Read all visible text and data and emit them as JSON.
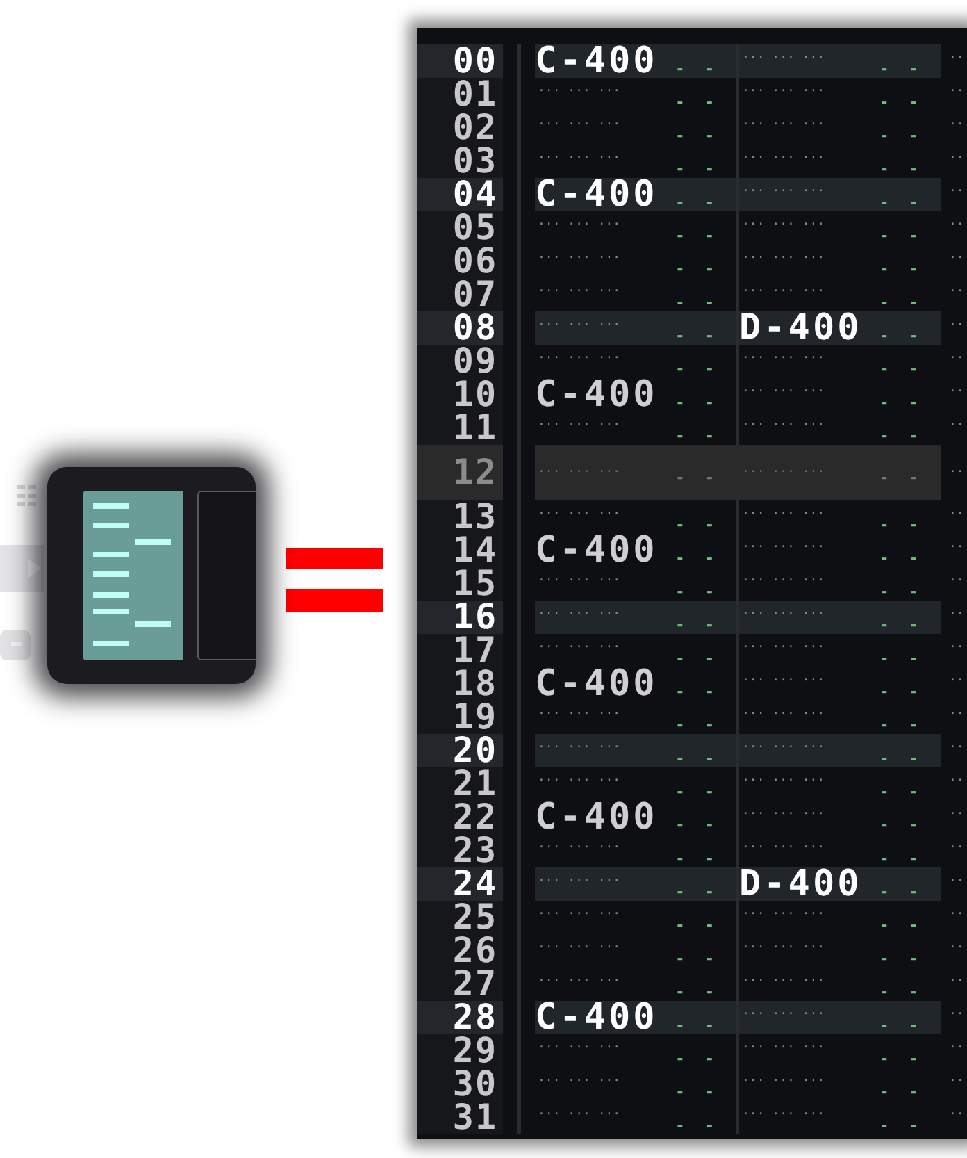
{
  "toolbar": {
    "pattern_button": {
      "selected": true
    }
  },
  "pattern": {
    "rows": [
      {
        "number": "00",
        "kind": "beat",
        "cells": [
          {
            "note": "C-400",
            "params": "- -"
          },
          {
            "note": "··· ··· ···",
            "params": "- -"
          }
        ],
        "edge": "···"
      },
      {
        "number": "01",
        "kind": "normal",
        "cells": [
          {
            "note": "··· ··· ···",
            "params": "- -"
          },
          {
            "note": "··· ··· ···",
            "params": "- -"
          }
        ],
        "edge": "···"
      },
      {
        "number": "02",
        "kind": "normal",
        "cells": [
          {
            "note": "··· ··· ···",
            "params": "- -"
          },
          {
            "note": "··· ··· ···",
            "params": "- -"
          }
        ],
        "edge": "···"
      },
      {
        "number": "03",
        "kind": "normal",
        "cells": [
          {
            "note": "··· ··· ···",
            "params": "- -"
          },
          {
            "note": "··· ··· ···",
            "params": "- -"
          }
        ],
        "edge": "···"
      },
      {
        "number": "04",
        "kind": "beat",
        "cells": [
          {
            "note": "C-400",
            "params": "- -"
          },
          {
            "note": "··· ··· ···",
            "params": "- -"
          }
        ],
        "edge": "···"
      },
      {
        "number": "05",
        "kind": "normal",
        "cells": [
          {
            "note": "··· ··· ···",
            "params": "- -"
          },
          {
            "note": "··· ··· ···",
            "params": "- -"
          }
        ],
        "edge": "···"
      },
      {
        "number": "06",
        "kind": "normal",
        "cells": [
          {
            "note": "··· ··· ···",
            "params": "- -"
          },
          {
            "note": "··· ··· ···",
            "params": "- -"
          }
        ],
        "edge": "···"
      },
      {
        "number": "07",
        "kind": "normal",
        "cells": [
          {
            "note": "··· ··· ···",
            "params": "- -"
          },
          {
            "note": "··· ··· ···",
            "params": "- -"
          }
        ],
        "edge": "···"
      },
      {
        "number": "08",
        "kind": "beat",
        "cells": [
          {
            "note": "··· ··· ···",
            "params": "- -"
          },
          {
            "note": "D-400",
            "params": "- -"
          }
        ],
        "edge": "···"
      },
      {
        "number": "09",
        "kind": "normal",
        "cells": [
          {
            "note": "··· ··· ···",
            "params": "- -"
          },
          {
            "note": "··· ··· ···",
            "params": "- -"
          }
        ],
        "edge": "···"
      },
      {
        "number": "10",
        "kind": "normal",
        "cells": [
          {
            "note": "C-400",
            "params": "- -"
          },
          {
            "note": "··· ··· ···",
            "params": "- -"
          }
        ],
        "edge": "···"
      },
      {
        "number": "11",
        "kind": "normal",
        "cells": [
          {
            "note": "··· ··· ···",
            "params": "- -"
          },
          {
            "note": "··· ··· ···",
            "params": "- -"
          }
        ],
        "edge": "···"
      },
      {
        "number": "12",
        "kind": "current",
        "cells": [
          {
            "note": "··· ··· ···",
            "params": "- -"
          },
          {
            "note": "··· ··· ···",
            "params": "- -"
          }
        ],
        "edge": "···"
      },
      {
        "number": "13",
        "kind": "normal",
        "cells": [
          {
            "note": "··· ··· ···",
            "params": "- -"
          },
          {
            "note": "··· ··· ···",
            "params": "- -"
          }
        ],
        "edge": "···"
      },
      {
        "number": "14",
        "kind": "normal",
        "cells": [
          {
            "note": "C-400",
            "params": "- -"
          },
          {
            "note": "··· ··· ···",
            "params": "- -"
          }
        ],
        "edge": "···"
      },
      {
        "number": "15",
        "kind": "normal",
        "cells": [
          {
            "note": "··· ··· ···",
            "params": "- -"
          },
          {
            "note": "··· ··· ···",
            "params": "- -"
          }
        ],
        "edge": "···"
      },
      {
        "number": "16",
        "kind": "beat",
        "cells": [
          {
            "note": "··· ··· ···",
            "params": "- -"
          },
          {
            "note": "··· ··· ···",
            "params": "- -"
          }
        ],
        "edge": "···"
      },
      {
        "number": "17",
        "kind": "normal",
        "cells": [
          {
            "note": "··· ··· ···",
            "params": "- -"
          },
          {
            "note": "··· ··· ···",
            "params": "- -"
          }
        ],
        "edge": "···"
      },
      {
        "number": "18",
        "kind": "normal",
        "cells": [
          {
            "note": "C-400",
            "params": "- -"
          },
          {
            "note": "··· ··· ···",
            "params": "- -"
          }
        ],
        "edge": "···"
      },
      {
        "number": "19",
        "kind": "normal",
        "cells": [
          {
            "note": "··· ··· ···",
            "params": "- -"
          },
          {
            "note": "··· ··· ···",
            "params": "- -"
          }
        ],
        "edge": "···"
      },
      {
        "number": "20",
        "kind": "beat",
        "cells": [
          {
            "note": "··· ··· ···",
            "params": "- -"
          },
          {
            "note": "··· ··· ···",
            "params": "- -"
          }
        ],
        "edge": "···"
      },
      {
        "number": "21",
        "kind": "normal",
        "cells": [
          {
            "note": "··· ··· ···",
            "params": "- -"
          },
          {
            "note": "··· ··· ···",
            "params": "- -"
          }
        ],
        "edge": "···"
      },
      {
        "number": "22",
        "kind": "normal",
        "cells": [
          {
            "note": "C-400",
            "params": "- -"
          },
          {
            "note": "··· ··· ···",
            "params": "- -"
          }
        ],
        "edge": "···"
      },
      {
        "number": "23",
        "kind": "normal",
        "cells": [
          {
            "note": "··· ··· ···",
            "params": "- -"
          },
          {
            "note": "··· ··· ···",
            "params": "- -"
          }
        ],
        "edge": "···"
      },
      {
        "number": "24",
        "kind": "beat",
        "cells": [
          {
            "note": "··· ··· ···",
            "params": "- -"
          },
          {
            "note": "D-400",
            "params": "- -"
          }
        ],
        "edge": "···"
      },
      {
        "number": "25",
        "kind": "normal",
        "cells": [
          {
            "note": "··· ··· ···",
            "params": "- -"
          },
          {
            "note": "··· ··· ···",
            "params": "- -"
          }
        ],
        "edge": "···"
      },
      {
        "number": "26",
        "kind": "normal",
        "cells": [
          {
            "note": "··· ··· ···",
            "params": "- -"
          },
          {
            "note": "··· ··· ···",
            "params": "- -"
          }
        ],
        "edge": "···"
      },
      {
        "number": "27",
        "kind": "normal",
        "cells": [
          {
            "note": "··· ··· ···",
            "params": "- -"
          },
          {
            "note": "··· ··· ···",
            "params": "- -"
          }
        ],
        "edge": "···"
      },
      {
        "number": "28",
        "kind": "beat",
        "cells": [
          {
            "note": "C-400",
            "params": "- -"
          },
          {
            "note": "··· ··· ···",
            "params": "- -"
          }
        ],
        "edge": "···"
      },
      {
        "number": "29",
        "kind": "normal",
        "cells": [
          {
            "note": "··· ··· ···",
            "params": "- -"
          },
          {
            "note": "··· ··· ···",
            "params": "- -"
          }
        ],
        "edge": "···"
      },
      {
        "number": "30",
        "kind": "normal",
        "cells": [
          {
            "note": "··· ··· ···",
            "params": "- -"
          },
          {
            "note": "··· ··· ···",
            "params": "- -"
          }
        ],
        "edge": "···"
      },
      {
        "number": "31",
        "kind": "normal",
        "cells": [
          {
            "note": "··· ··· ···",
            "params": "- -"
          },
          {
            "note": "··· ··· ···",
            "params": "- -"
          }
        ],
        "edge": "···"
      }
    ]
  }
}
